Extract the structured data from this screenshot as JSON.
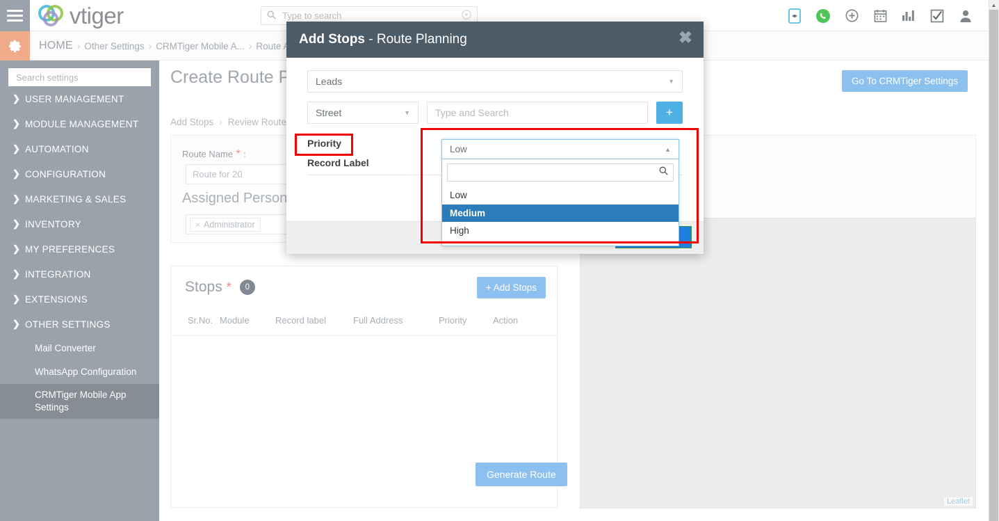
{
  "topbar": {
    "brand": "vtiger",
    "menu_icon": "hamburger-icon",
    "search": {
      "placeholder": "Type to search",
      "value": ""
    },
    "icons": [
      {
        "name": "mobile-app-icon",
        "glyph": "⌗"
      },
      {
        "name": "whatsapp-icon",
        "glyph": "✆"
      },
      {
        "name": "add-circle-icon",
        "glyph": "⊕"
      },
      {
        "name": "calendar-icon",
        "glyph": "Ὄ5"
      },
      {
        "name": "analytics-icon",
        "glyph": "ὌA"
      },
      {
        "name": "tasks-checkbox-icon",
        "glyph": "☑"
      },
      {
        "name": "user-profile-icon",
        "glyph": "὆4"
      }
    ]
  },
  "breadcrumb": {
    "gear_icon": "gear-icon",
    "items": [
      "HOME",
      "Other Settings",
      "CRMTiger Mobile A...",
      "Route Activities"
    ],
    "separator": "›"
  },
  "sidebar": {
    "search_placeholder": "Search settings",
    "groups": [
      {
        "label": "USER MANAGEMENT",
        "expanded": false
      },
      {
        "label": "MODULE MANAGEMENT",
        "expanded": false
      },
      {
        "label": "AUTOMATION",
        "expanded": false
      },
      {
        "label": "CONFIGURATION",
        "expanded": false
      },
      {
        "label": "MARKETING & SALES",
        "expanded": false
      },
      {
        "label": "INVENTORY",
        "expanded": false
      },
      {
        "label": "MY PREFERENCES",
        "expanded": false
      },
      {
        "label": "INTEGRATION",
        "expanded": false
      },
      {
        "label": "EXTENSIONS",
        "expanded": false
      },
      {
        "label": "OTHER SETTINGS",
        "expanded": true
      }
    ],
    "sub_items": [
      {
        "label": "Mail Converter",
        "active": false
      },
      {
        "label": "WhatsApp Configuration",
        "active": false
      },
      {
        "label": "CRMTiger Mobile App Settings",
        "active": true
      }
    ]
  },
  "main": {
    "page_title": "Create Route Plan",
    "settings_button": "Go To CRMTiger Settings",
    "wizard": {
      "step1": "Add Stops",
      "sep": "›",
      "step2": "Review Route"
    },
    "route_name_label": "Route Name",
    "route_name_required": "*",
    "route_name_colon": ":",
    "route_name_value": "Route for 20",
    "assigned_person_label": "Assigned Person",
    "assigned_person_token": "Administrator",
    "token_remove": "×",
    "stops": {
      "title": "Stops",
      "required": "*",
      "count": "0",
      "add_button": "Add Stops",
      "add_button_icon": "+",
      "columns": [
        "Sr.No.",
        "Module",
        "Record label",
        "Full Address",
        "Priority",
        "Action"
      ],
      "rows": []
    },
    "map": {
      "attribution": "Leaflet"
    },
    "generate_button": "Generate Route"
  },
  "modal": {
    "title_main": "Add Stops",
    "title_dash": " - ",
    "title_sub": "Route Planning",
    "close_glyph": "✖",
    "module_select": {
      "value": "Leads",
      "caret": "▼"
    },
    "field_select": {
      "value": "Street",
      "caret": "▼"
    },
    "search_input": {
      "placeholder": "Type and Search",
      "value": ""
    },
    "add_button_glyph": "+",
    "priority_label": "Priority",
    "record_label_label": "Record Label",
    "priority_dropdown": {
      "selected": "Low",
      "caret": "▲",
      "search_value": "",
      "search_icon": "ὐD",
      "options": [
        {
          "label": "Low",
          "highlighted": false
        },
        {
          "label": "Medium",
          "highlighted": true
        },
        {
          "label": "High",
          "highlighted": false
        }
      ]
    }
  },
  "colors": {
    "modal_header": "#4c5b68",
    "sidebar": "#9aa3ab",
    "accent_blue": "#8cc0ef",
    "plus_blue": "#4fb0e3",
    "annotation_red": "#f40000",
    "option_highlight": "#2d7cba",
    "gear_orange": "#f0ab8a"
  }
}
